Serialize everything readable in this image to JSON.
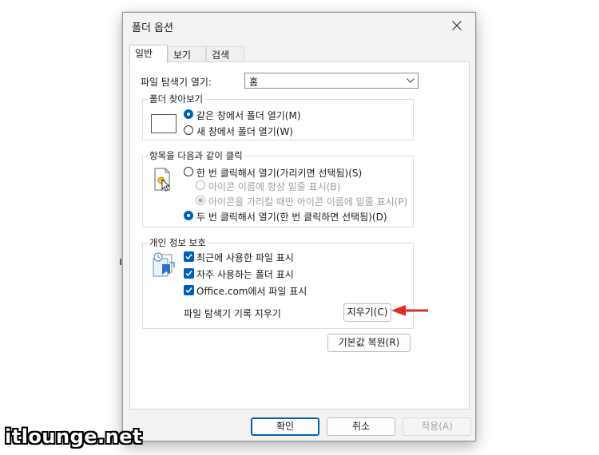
{
  "dialog": {
    "title": "폴더 옵션"
  },
  "tabs": [
    {
      "label": "일반",
      "active": true
    },
    {
      "label": "보기",
      "active": false
    },
    {
      "label": "검색",
      "active": false
    }
  ],
  "general": {
    "open_explorer_label": "파일 탐색기 열기:",
    "open_explorer_value": "홈",
    "browse": {
      "title": "폴더 찾아보기",
      "options": [
        {
          "label": "같은 창에서 폴더 열기(M)",
          "checked": true
        },
        {
          "label": "새 창에서 폴더 열기(W)",
          "checked": false
        }
      ]
    },
    "click": {
      "title": "항목을 다음과 같이 클릭",
      "options": [
        {
          "label": "한 번 클릭해서 열기(가리키면 선택됨)(S)",
          "checked": false,
          "enabled": true
        },
        {
          "label": "아이콘 이름에 항상 밑줄 표시(B)",
          "checked": false,
          "enabled": false
        },
        {
          "label": "아이콘을 가리킬 때만 아이콘 이름에 밑줄 표시(P)",
          "checked": true,
          "enabled": false
        },
        {
          "label": "두 번 클릭해서 열기(한 번 클릭하면 선택됨)(D)",
          "checked": true,
          "enabled": true
        }
      ]
    },
    "privacy": {
      "title": "개인 정보 보호",
      "checks": [
        {
          "label": "최근에 사용한 파일 표시",
          "checked": true
        },
        {
          "label": "자주 사용하는 폴더 표시",
          "checked": true
        },
        {
          "label": "Office.com에서 파일 표시",
          "checked": true
        }
      ],
      "clear_label": "파일 탐색기 기록 지우기",
      "clear_button": "지우기(C)"
    },
    "restore_button": "기본값 복원(R)"
  },
  "footer": {
    "ok": "확인",
    "cancel": "취소",
    "apply": "적용(A)"
  },
  "colors": {
    "accent": "#005fb8",
    "annotation_arrow": "#e02b2b"
  },
  "watermark": "itlounge.net"
}
